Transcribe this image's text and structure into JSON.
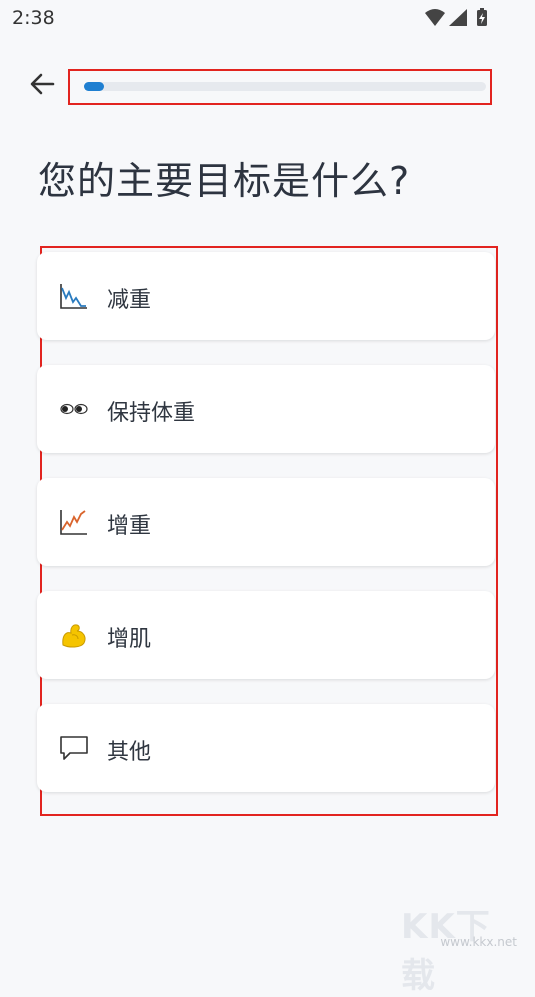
{
  "status_bar": {
    "time": "2:38",
    "icons": [
      "wifi-icon",
      "signal-icon",
      "battery-charging-icon"
    ]
  },
  "header": {
    "back_icon": "arrow-left-icon",
    "progress_fraction": 0.05,
    "progress_color": "#1f7fd1"
  },
  "title": "您的主要目标是什么?",
  "options": [
    {
      "label": "减重",
      "icon": "chart-down-icon"
    },
    {
      "label": "保持体重",
      "icon": "eyes-icon"
    },
    {
      "label": "增重",
      "icon": "chart-up-icon"
    },
    {
      "label": "增肌",
      "icon": "flexed-biceps-icon"
    },
    {
      "label": "其他",
      "icon": "speech-bubble-icon"
    }
  ],
  "watermark": {
    "brand": "KK下载",
    "url": "www.kkx.net"
  },
  "colors": {
    "accent": "#1f7fd1",
    "highlight_frame": "#e2241f",
    "background": "#f7f8fa"
  }
}
